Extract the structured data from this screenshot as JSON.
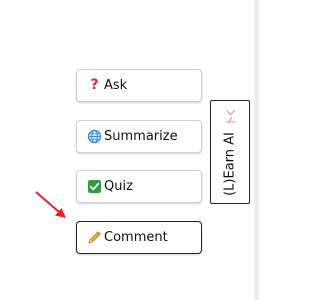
{
  "actions": {
    "ask": {
      "label": "Ask",
      "icon": "question-mark-icon"
    },
    "summarize": {
      "label": "Summarize",
      "icon": "globe-icon"
    },
    "quiz": {
      "label": "Quiz",
      "icon": "check-box-icon"
    },
    "comment": {
      "label": "Comment",
      "icon": "pencil-icon"
    }
  },
  "side_panel": {
    "label": "(L)Earn AI",
    "logo_text": "卜く",
    "logo_color": "#e46a7a"
  },
  "pointer": {
    "icon": "red-arrow-icon",
    "color": "#e0262c"
  },
  "colors": {
    "ask_icon": "#d7262f",
    "quiz_icon": "#2e9e3c",
    "globe_icon": "#3b87d9"
  }
}
